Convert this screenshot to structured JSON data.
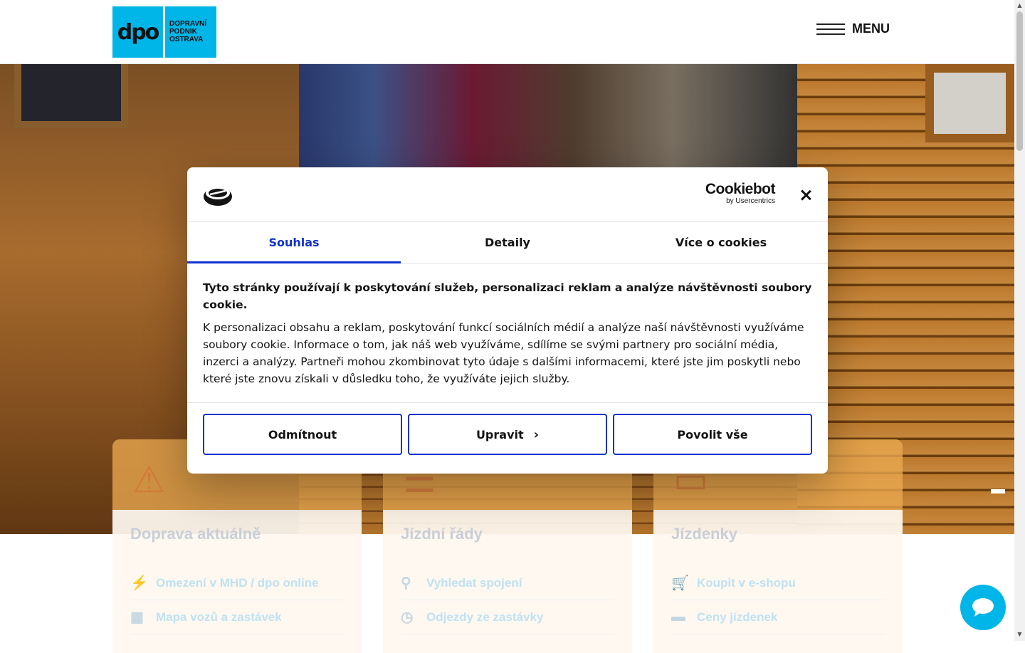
{
  "brand": {
    "logo_mark": "dpo",
    "logo_text_line1": "DOPRAVNÍ",
    "logo_text_line2": "PODNIK",
    "logo_text_line3": "OSTRAVA",
    "accent": "#00b5e8"
  },
  "header": {
    "menu_label": "MENU"
  },
  "cards": [
    {
      "icon": "warning-icon",
      "title": "Doprava aktuálně",
      "links": [
        {
          "icon": "bolt-icon",
          "label": "Omezení v MHD / dpo online"
        },
        {
          "icon": "map-icon",
          "label": "Mapa vozů a zastávek"
        }
      ]
    },
    {
      "icon": "timetable-icon",
      "title": "Jízdní řády",
      "links": [
        {
          "icon": "search-icon",
          "label": "Vyhledat spojení"
        },
        {
          "icon": "departures-icon",
          "label": "Odjezdy ze zastávky"
        }
      ]
    },
    {
      "icon": "ticket-icon",
      "title": "Jízdenky",
      "links": [
        {
          "icon": "cart-icon",
          "label": "Koupit v e-shopu"
        },
        {
          "icon": "wallet-icon",
          "label": "Ceny jízdenek"
        }
      ]
    }
  ],
  "cookie": {
    "brand_name": "Cookiebot",
    "brand_by": "by Usercentrics",
    "tabs": [
      "Souhlas",
      "Detaily",
      "Více o cookies"
    ],
    "active_tab": "Souhlas",
    "heading": "Tyto stránky používají k poskytování služeb, personalizaci reklam a analýze návštěvnosti soubory cookie.",
    "text": "K personalizaci obsahu a reklam, poskytování funkcí sociálních médií a analýze naší návštěvnosti využíváme soubory cookie. Informace o tom, jak náš web využíváme, sdílíme se svými partnery pro sociální média, inzerci a analýzy. Partneři mohou zkombinovat tyto údaje s dalšími informacemi, které jste jim poskytli nebo které jste znovu získali v důsledku toho, že využíváte jejich služby.",
    "buttons": {
      "reject": "Odmítnout",
      "customize": "Upravit",
      "allow_all": "Povolit vše"
    },
    "accent": "#1032cf"
  }
}
